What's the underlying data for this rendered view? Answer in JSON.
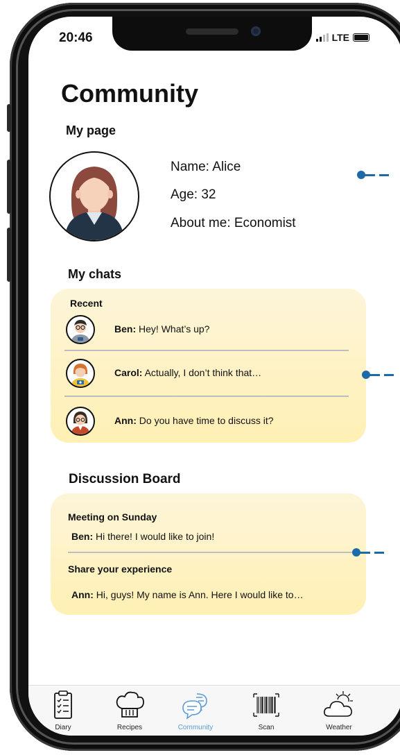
{
  "status_bar": {
    "time": "20:46",
    "network": "LTE"
  },
  "page_title": "Community",
  "my_page": {
    "heading": "My page",
    "name": "Name: Alice",
    "age": "Age: 32",
    "about": "About me: Economist"
  },
  "my_chats": {
    "heading": "My chats",
    "subheading": "Recent",
    "items": [
      {
        "name": "Ben:",
        "message": " Hey! What’s up?"
      },
      {
        "name": "Carol:",
        "message": " Actually, I don’t think that…"
      },
      {
        "name": "Ann:",
        "message": " Do you have time to discuss it?"
      }
    ]
  },
  "discussion_board": {
    "heading": "Discussion Board",
    "threads": [
      {
        "title": "Meeting on Sunday",
        "author": "Ben:",
        "text": " Hi there! I would like to join!"
      },
      {
        "title": "Share your experience",
        "author": "Ann:",
        "text": " Hi, guys! My name is Ann. Here I would like to…"
      }
    ]
  },
  "tabs": [
    {
      "label": "Diary",
      "icon": "clipboard-checklist-icon"
    },
    {
      "label": "Recipes",
      "icon": "chef-hat-icon"
    },
    {
      "label": "Community",
      "icon": "chat-bubbles-icon",
      "active": true
    },
    {
      "label": "Scan",
      "icon": "barcode-icon"
    },
    {
      "label": "Weather",
      "icon": "cloud-sun-icon"
    }
  ],
  "colors": {
    "accent": "#5b9bd5",
    "card": "#fff0b4",
    "callout": "#1d6aa8"
  }
}
